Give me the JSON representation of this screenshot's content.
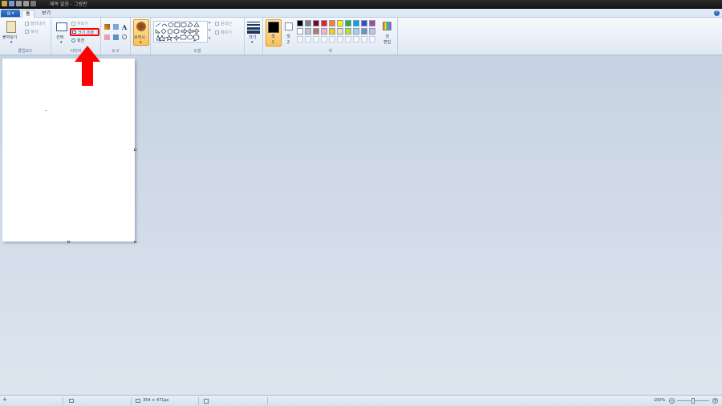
{
  "window": {
    "title": "제목 없음 - 그림판"
  },
  "tabs": {
    "file": "▤ ▾",
    "home": "홈",
    "view": "보기"
  },
  "clipboard": {
    "paste": "붙여넣기",
    "cut": "잘라내기",
    "copy": "복사",
    "group": "클립보드"
  },
  "image": {
    "select": "선택",
    "crop": "자르기",
    "resize": "크기 조정",
    "rotate": "회전",
    "group": "이미지"
  },
  "tools": {
    "text_glyph": "A",
    "group": "도구"
  },
  "brushes": {
    "label": "브러시"
  },
  "shapes": {
    "outline": "윤곽선",
    "fill": "채우기",
    "group": "도형"
  },
  "size": {
    "label": "크기"
  },
  "colors": {
    "color1": "색\n1",
    "color2": "색\n2",
    "edit": "색\n편집",
    "group": "색",
    "palette_row1": [
      "#000000",
      "#7f7f7f",
      "#880015",
      "#ed1c24",
      "#ff7f27",
      "#fff200",
      "#22b14c",
      "#00a2e8",
      "#3f48cc",
      "#a349a4"
    ],
    "palette_row2": [
      "#ffffff",
      "#c3c3c3",
      "#b97a57",
      "#ffaec9",
      "#ffc90e",
      "#efe4b0",
      "#b5e61d",
      "#99d9ea",
      "#7092be",
      "#c8bfe7"
    ]
  },
  "status": {
    "dimensions": "354 × 471px",
    "zoom": "100%"
  },
  "annotation": {
    "highlight_color": "#ff0000"
  }
}
